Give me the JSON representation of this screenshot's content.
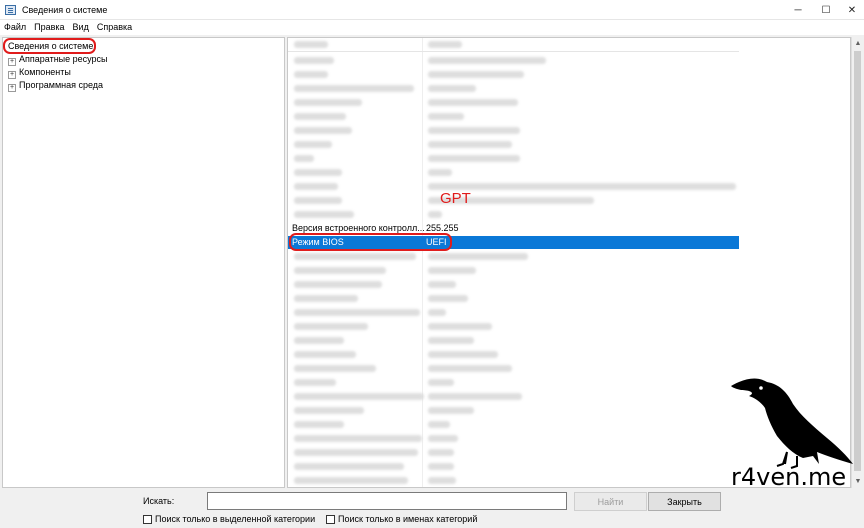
{
  "window": {
    "title": "Сведения о системе",
    "icon": "sysinfo-app-icon",
    "controls": {
      "minimize": "─",
      "maximize": "☐",
      "close": "✕"
    }
  },
  "menu": [
    "Файл",
    "Правка",
    "Вид",
    "Справка"
  ],
  "tree": {
    "root": "Сведения о системе",
    "children": [
      {
        "label": "Аппаратные ресурсы",
        "expander": "+"
      },
      {
        "label": "Компоненты",
        "expander": "+"
      },
      {
        "label": "Программная среда",
        "expander": "+"
      }
    ]
  },
  "details": {
    "partial_row": {
      "element": "Версия встроенного контролл...",
      "value": "255.255"
    },
    "selected_row": {
      "element": "Режим BIOS",
      "value": "UEFI"
    },
    "annotation": "GPT",
    "colors": {
      "selection": "#0a78d7",
      "annotation": "#e01b1b"
    }
  },
  "search": {
    "label": "Искать:",
    "value": "",
    "find_button": "Найти",
    "close_button": "Закрыть",
    "option_selected_category": "Поиск только в выделенной категории",
    "option_category_names": "Поиск только в именах категорий"
  },
  "scrollbar": {
    "up": "▲",
    "down": "▼"
  },
  "watermark": {
    "text": "r4ven.me",
    "image": "raven-silhouette"
  }
}
